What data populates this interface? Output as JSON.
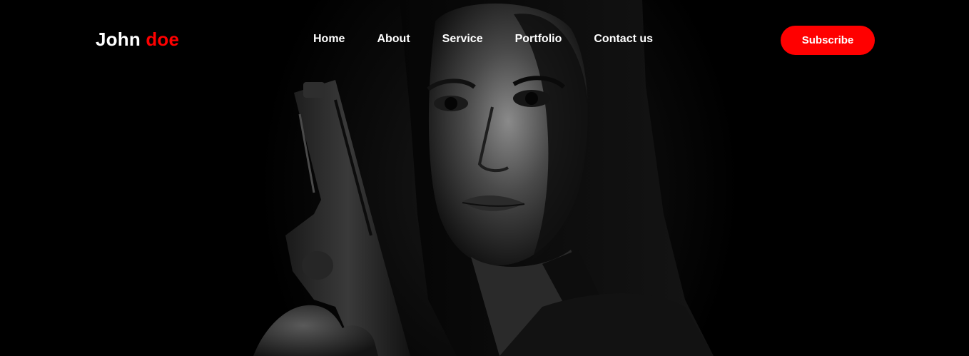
{
  "brand": {
    "first": "John",
    "accent": "doe",
    "accent_color": "#ff0000"
  },
  "nav": {
    "items": [
      {
        "label": "Home"
      },
      {
        "label": "About"
      },
      {
        "label": "Service"
      },
      {
        "label": "Portfolio"
      },
      {
        "label": "Contact us"
      }
    ]
  },
  "cta": {
    "subscribe_label": "Subscribe",
    "color": "#ff0000"
  },
  "hero": {
    "image": "woman-holding-pistol-photo",
    "tone": "black-and-white"
  }
}
